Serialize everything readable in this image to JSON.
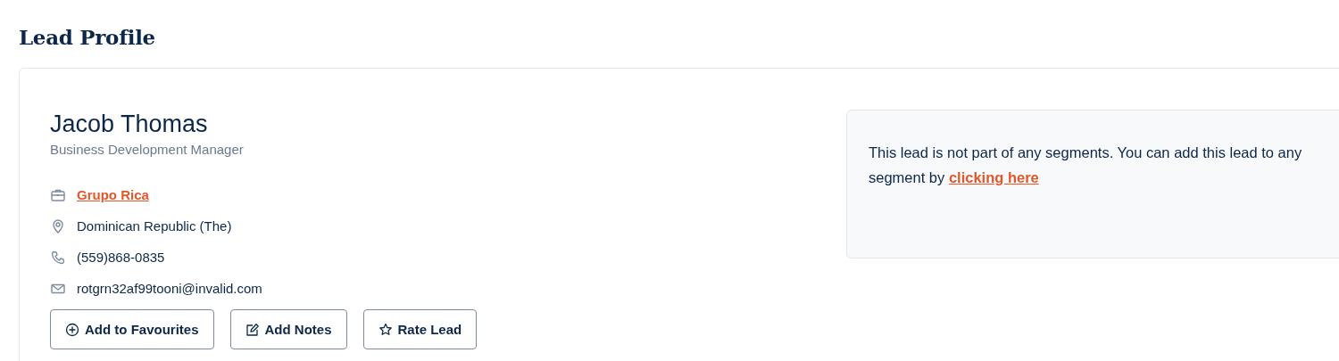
{
  "page_title": "Lead Profile",
  "lead": {
    "name": "Jacob Thomas",
    "job_title": "Business Development Manager",
    "details": [
      {
        "kind": "company",
        "text": "Grupo Rica"
      },
      {
        "kind": "location",
        "text": "Dominican Republic (The)"
      },
      {
        "kind": "phone",
        "text": "(559)868-0835"
      },
      {
        "kind": "email",
        "text": "rotgrn32af99tooni@invalid.com"
      }
    ],
    "buttons": [
      {
        "kind": "favourite",
        "label": "Add to Favourites"
      },
      {
        "kind": "notes",
        "label": "Add Notes"
      },
      {
        "kind": "rate",
        "label": "Rate Lead"
      }
    ]
  },
  "segments_panel": {
    "message": "This lead is not part of any segments. You can add this lead to any segment by",
    "link": "clicking here"
  }
}
